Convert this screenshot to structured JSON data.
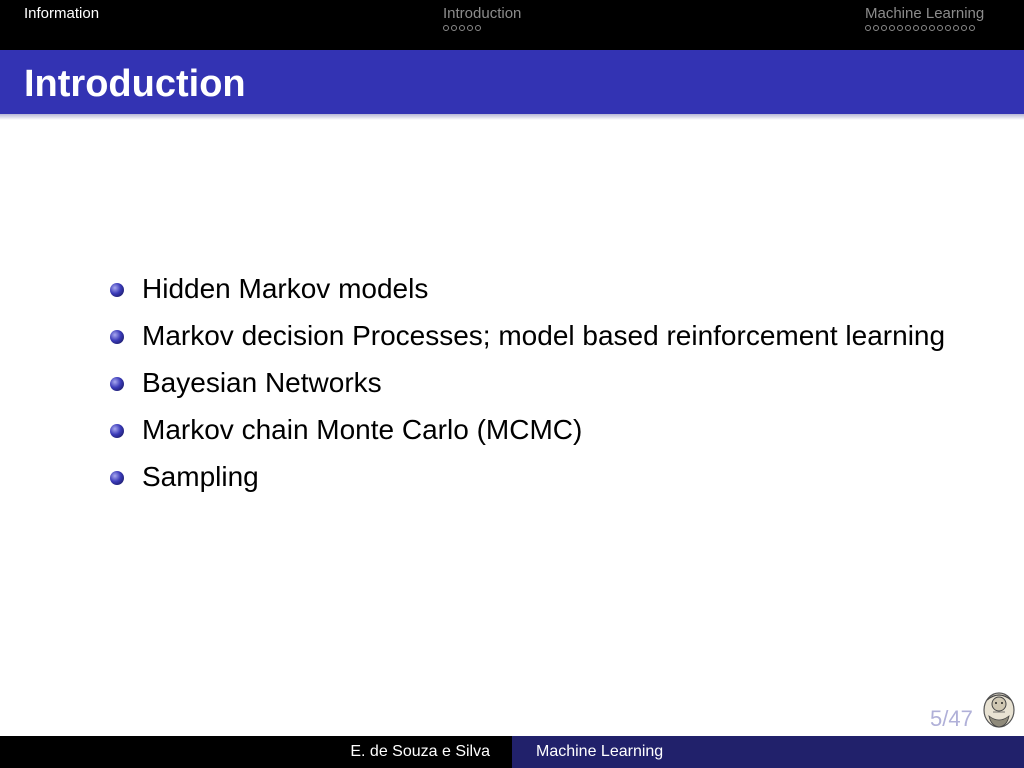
{
  "nav": {
    "sections": [
      {
        "label": "Information",
        "dots": 0,
        "active": true
      },
      {
        "label": "Introduction",
        "dots": 5,
        "active": false
      },
      {
        "label": "Machine Learning",
        "dots": 14,
        "active": false
      }
    ]
  },
  "frame": {
    "title": "Introduction",
    "bullets": [
      "Hidden Markov models",
      "Markov decision Processes; model based reinforcement learning",
      "Bayesian Networks",
      "Markov chain Monte Carlo (MCMC)",
      "Sampling"
    ]
  },
  "page": {
    "number": "5/47"
  },
  "footer": {
    "author": "E. de Souza e Silva",
    "title": "Machine Learning"
  },
  "colors": {
    "title_bar": "#3333b3",
    "footer_right": "#21216b",
    "nav_bar": "#000000"
  }
}
